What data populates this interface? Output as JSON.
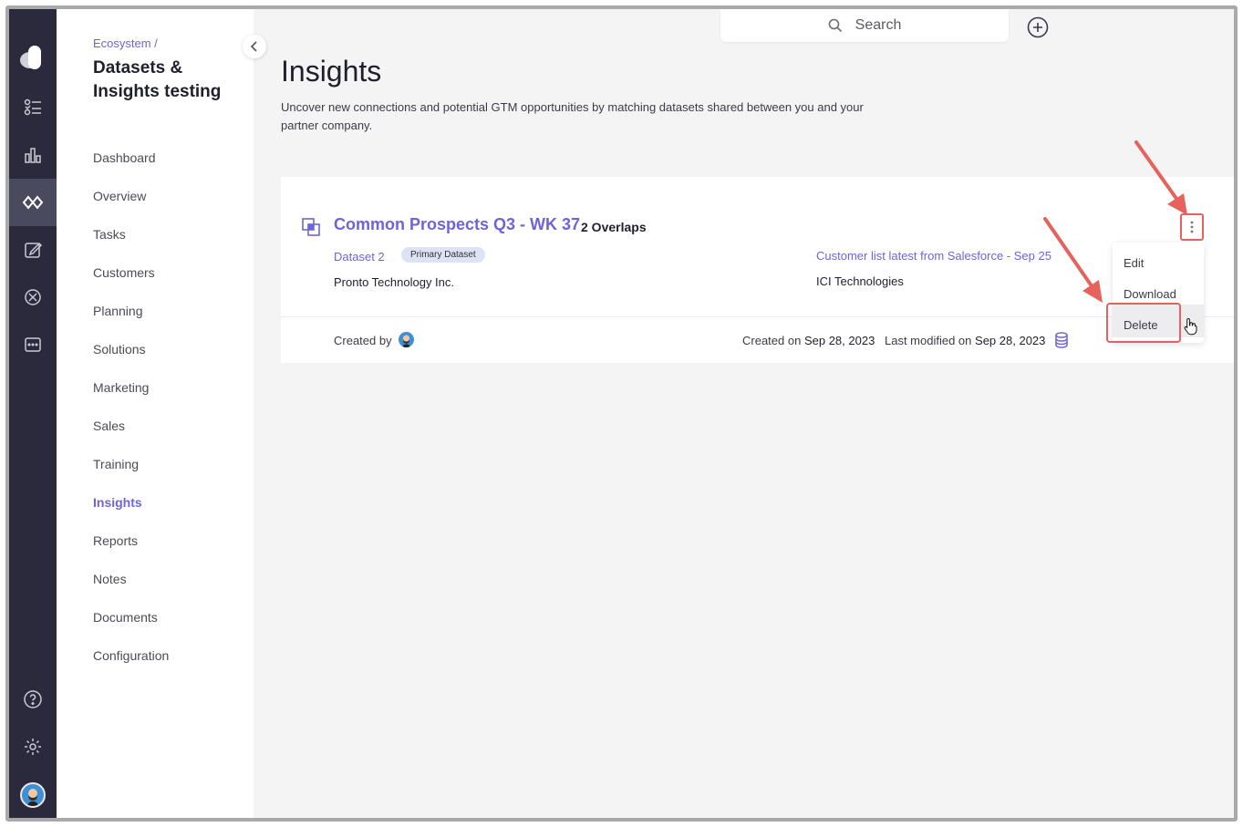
{
  "sidebar_rail": {
    "items": [
      {
        "name": "tasks-icon"
      },
      {
        "name": "analytics-icon"
      },
      {
        "name": "ecosystem-icon",
        "active": true
      },
      {
        "name": "notes-icon"
      },
      {
        "name": "explore-icon"
      },
      {
        "name": "messages-icon"
      }
    ],
    "bottom": [
      "help-icon",
      "settings-icon",
      "user-avatar"
    ]
  },
  "sidebar": {
    "breadcrumb": "Ecosystem /",
    "title": "Datasets & Insights testing",
    "nav": [
      "Dashboard",
      "Overview",
      "Tasks",
      "Customers",
      "Planning",
      "Solutions",
      "Marketing",
      "Sales",
      "Training",
      "Insights",
      "Reports",
      "Notes",
      "Documents",
      "Configuration"
    ],
    "active_nav": "Insights"
  },
  "search": {
    "placeholder": "Search"
  },
  "page": {
    "title": "Insights",
    "description": "Uncover new connections and potential GTM opportunities by matching datasets shared between you and your partner company."
  },
  "insight_card": {
    "title": "Common Prospects Q3 - WK 37",
    "overlaps": "2 Overlaps",
    "primary_dataset_name": "Dataset 2",
    "primary_badge": "Primary Dataset",
    "primary_company": "Pronto Technology Inc.",
    "secondary_dataset_name": "Customer list latest from Salesforce - Sep 25",
    "secondary_company": "ICI Technologies",
    "created_by_label": "Created by",
    "created_on_label": "Created on",
    "created_on": "Sep 28, 2023",
    "last_modified_label": "Last modified on",
    "last_modified": "Sep 28, 2023"
  },
  "context_menu": {
    "items": [
      "Edit",
      "Download",
      "Delete"
    ],
    "highlighted": "Delete"
  },
  "colors": {
    "accent": "#6e64d8",
    "rail": "#2a2a3c",
    "annotation": "#e5635c"
  }
}
